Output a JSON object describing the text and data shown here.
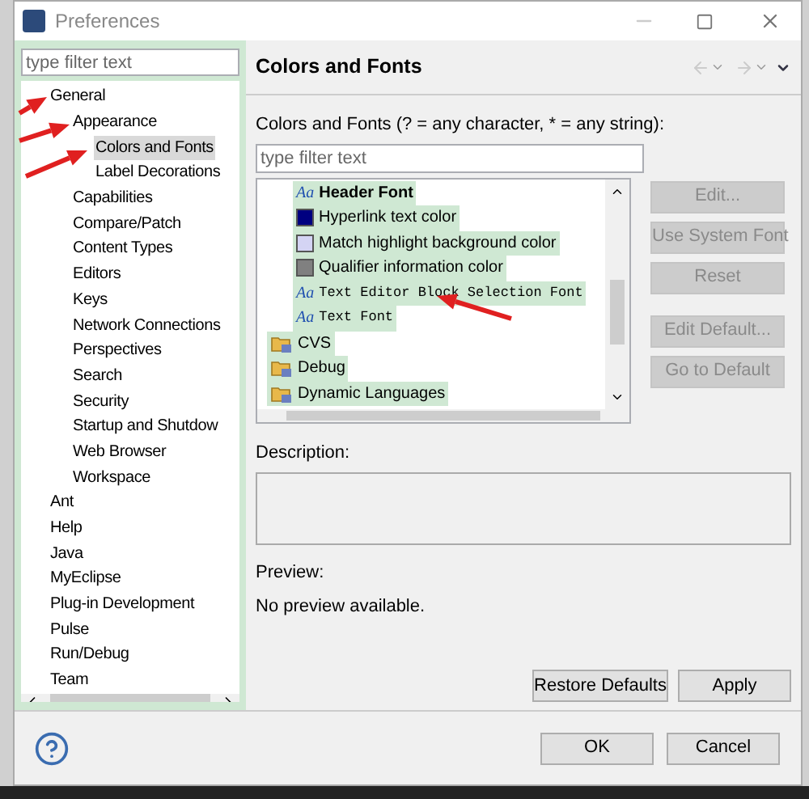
{
  "window": {
    "title": "Preferences"
  },
  "left_filter": {
    "placeholder": "type filter text"
  },
  "nav_tree": [
    {
      "label": "General",
      "selected": false,
      "children": [
        {
          "label": "Appearance",
          "selected": false,
          "children": [
            {
              "label": "Colors and Fonts",
              "selected": true
            },
            {
              "label": "Label Decorations",
              "selected": false
            }
          ]
        },
        {
          "label": "Capabilities",
          "selected": false
        },
        {
          "label": "Compare/Patch",
          "selected": false
        },
        {
          "label": "Content Types",
          "selected": false
        },
        {
          "label": "Editors",
          "selected": false
        },
        {
          "label": "Keys",
          "selected": false
        },
        {
          "label": "Network Connections",
          "selected": false
        },
        {
          "label": "Perspectives",
          "selected": false
        },
        {
          "label": "Search",
          "selected": false
        },
        {
          "label": "Security",
          "selected": false
        },
        {
          "label": "Startup and Shutdow",
          "selected": false
        },
        {
          "label": "Web Browser",
          "selected": false
        },
        {
          "label": "Workspace",
          "selected": false
        }
      ]
    },
    {
      "label": "Ant",
      "selected": false
    },
    {
      "label": "Help",
      "selected": false
    },
    {
      "label": "Java",
      "selected": false
    },
    {
      "label": "MyEclipse",
      "selected": false
    },
    {
      "label": "Plug-in Development",
      "selected": false
    },
    {
      "label": "Pulse",
      "selected": false
    },
    {
      "label": "Run/Debug",
      "selected": false
    },
    {
      "label": "Team",
      "selected": false
    }
  ],
  "page": {
    "title": "Colors and Fonts",
    "filter_label": "Colors and Fonts (? = any character, * = any string):",
    "filter": {
      "placeholder": "type filter text"
    }
  },
  "fonts_tree": [
    {
      "children": [
        {
          "label": "Header Font",
          "kind": "boldfont",
          "glyph": "Aa"
        },
        {
          "label": "Hyperlink text color",
          "kind": "color",
          "color": "#000080"
        },
        {
          "label": "Match highlight background color",
          "kind": "color",
          "color": "#d4d4f4"
        },
        {
          "label": "Qualifier information color",
          "kind": "color",
          "color": "#808080"
        },
        {
          "label": "Text Editor Block Selection Font",
          "kind": "monofont",
          "glyph": "Aa"
        },
        {
          "label": "Text Font",
          "kind": "monofont",
          "glyph": "Aa"
        }
      ]
    },
    {
      "label": "CVS",
      "kind": "folder"
    },
    {
      "label": "Debug",
      "kind": "folder"
    },
    {
      "label": "Dynamic Languages",
      "kind": "folder"
    }
  ],
  "side_buttons": [
    {
      "label": "Edit...",
      "disabled": true
    },
    {
      "label": "Use System Font",
      "disabled": true
    },
    {
      "label": "Reset",
      "disabled": true
    },
    {
      "label": "Edit Default...",
      "disabled": true
    },
    {
      "label": "Go to Default",
      "disabled": true
    }
  ],
  "description_label": "Description:",
  "preview_label": "Preview:",
  "preview_text": "No preview available.",
  "page_buttons": [
    "Restore Defaults",
    "Apply"
  ],
  "dialog_buttons": [
    "OK",
    "Cancel"
  ]
}
